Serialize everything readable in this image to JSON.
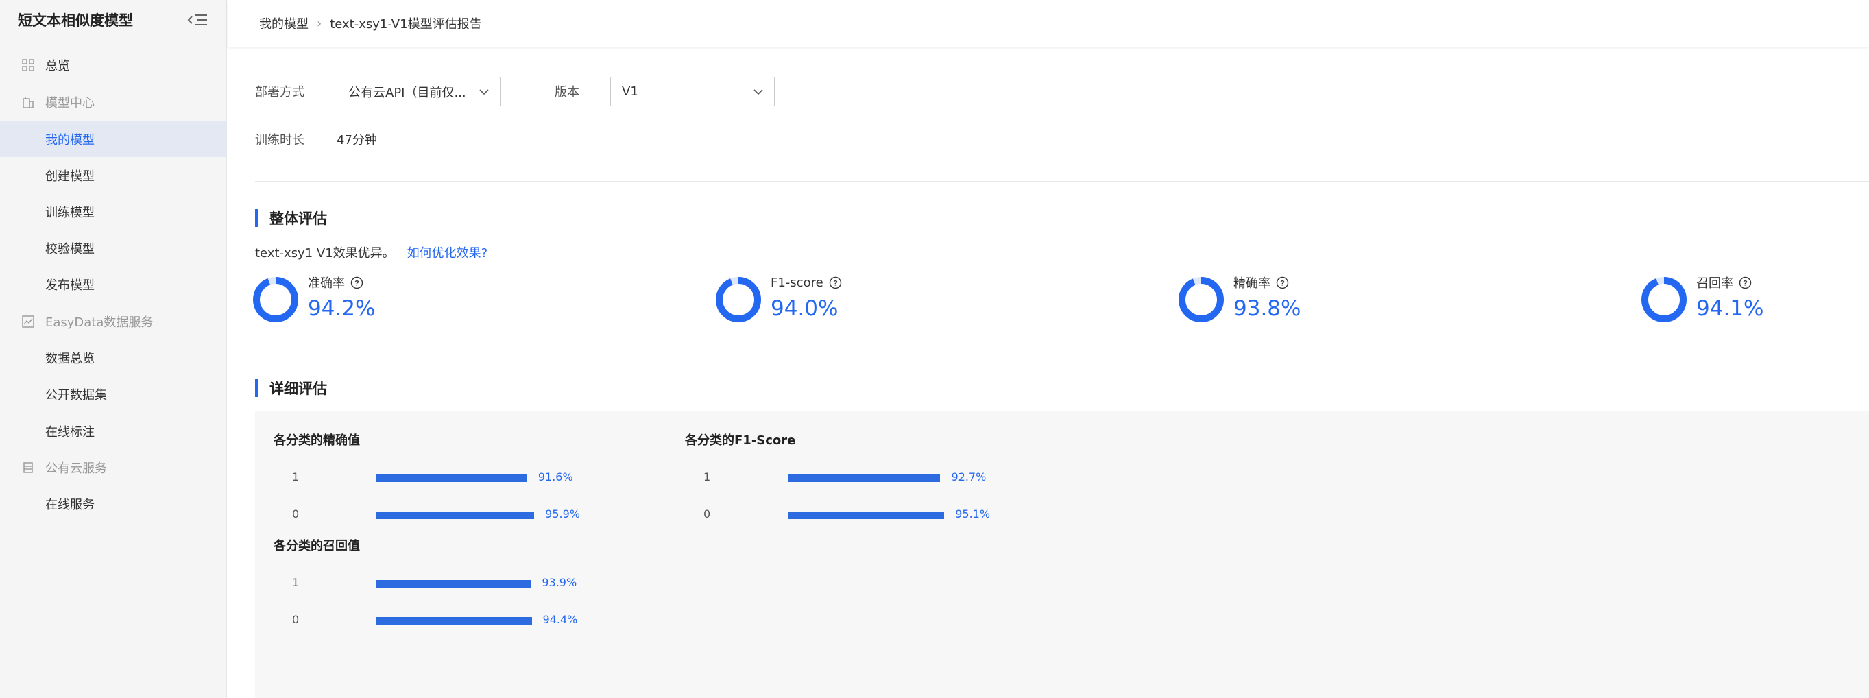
{
  "sidebar": {
    "title": "短文本相似度模型",
    "items": [
      {
        "label": "总览",
        "kind": "top",
        "icon": "grid-icon"
      },
      {
        "label": "模型中心",
        "kind": "group",
        "icon": "building-icon"
      },
      {
        "label": "我的模型",
        "kind": "link",
        "active": true
      },
      {
        "label": "创建模型",
        "kind": "link"
      },
      {
        "label": "训练模型",
        "kind": "link"
      },
      {
        "label": "校验模型",
        "kind": "link"
      },
      {
        "label": "发布模型",
        "kind": "link"
      },
      {
        "label": "EasyData数据服务",
        "kind": "group",
        "icon": "chart-icon"
      },
      {
        "label": "数据总览",
        "kind": "link"
      },
      {
        "label": "公开数据集",
        "kind": "link"
      },
      {
        "label": "在线标注",
        "kind": "link"
      },
      {
        "label": "公有云服务",
        "kind": "group",
        "icon": "server-icon"
      },
      {
        "label": "在线服务",
        "kind": "link"
      }
    ]
  },
  "breadcrumb": {
    "parent": "我的模型",
    "current": "text-xsy1-V1模型评估报告"
  },
  "form": {
    "deploy_label": "部署方式",
    "deploy_value": "公有云API（目前仅...",
    "version_label": "版本",
    "version_value": "V1",
    "duration_label": "训练时长",
    "duration_value": "47分钟"
  },
  "overall": {
    "title": "整体评估",
    "summary": "text-xsy1 V1效果优异。",
    "link": "如何优化效果?",
    "metrics": [
      {
        "label": "准确率",
        "value": "94.2%",
        "fraction": 0.942
      },
      {
        "label": "F1-score",
        "value": "94.0%",
        "fraction": 0.94
      },
      {
        "label": "精确率",
        "value": "93.8%",
        "fraction": 0.938
      },
      {
        "label": "召回率",
        "value": "94.1%",
        "fraction": 0.941
      }
    ]
  },
  "detail": {
    "title": "详细评估"
  },
  "chart_data": [
    {
      "type": "bar",
      "title": "各分类的精确值",
      "categories": [
        "1",
        "0"
      ],
      "values": [
        91.6,
        95.9
      ],
      "labels": [
        "91.6%",
        "95.9%"
      ],
      "xlim": [
        0,
        100
      ]
    },
    {
      "type": "bar",
      "title": "各分类的F1-Score",
      "categories": [
        "1",
        "0"
      ],
      "values": [
        92.7,
        95.1
      ],
      "labels": [
        "92.7%",
        "95.1%"
      ],
      "xlim": [
        0,
        100
      ]
    },
    {
      "type": "bar",
      "title": "各分类的召回值",
      "categories": [
        "1",
        "0"
      ],
      "values": [
        93.9,
        94.4
      ],
      "labels": [
        "93.9%",
        "94.4%"
      ],
      "xlim": [
        0,
        100
      ]
    }
  ],
  "colors": {
    "accent": "#2468f2",
    "bar": "#2c6be0",
    "donut_track": "#dfe8fb",
    "active_bg": "#e3e8f3"
  }
}
